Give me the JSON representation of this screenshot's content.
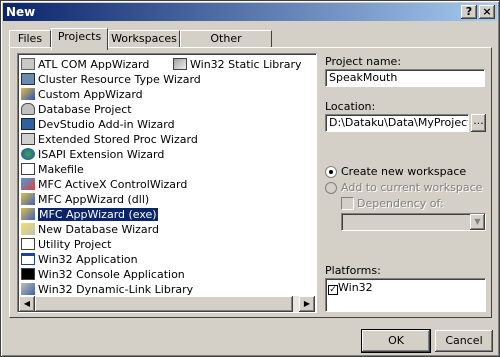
{
  "window": {
    "title": "New",
    "help_glyph": "?",
    "close_glyph": "×"
  },
  "tabs": [
    {
      "label": "Files"
    },
    {
      "label": "Projects"
    },
    {
      "label": "Workspaces"
    },
    {
      "label": "Other Documents"
    }
  ],
  "projects_list": {
    "column1": [
      "ATL COM AppWizard",
      "Cluster Resource Type Wizard",
      "Custom AppWizard",
      "Database Project",
      "DevStudio Add-in Wizard",
      "Extended Stored Proc Wizard",
      "ISAPI Extension Wizard",
      "Makefile",
      "MFC ActiveX ControlWizard",
      "MFC AppWizard (dll)",
      "MFC AppWizard (exe)",
      "New Database Wizard",
      "Utility Project",
      "Win32 Application",
      "Win32 Console Application",
      "Win32 Dynamic-Link Library"
    ],
    "column2": [
      "Win32 Static Library"
    ],
    "selected": "MFC AppWizard (exe)"
  },
  "project_name": {
    "label": "Project name:",
    "value": "SpeakMouth"
  },
  "location": {
    "label": "Location:",
    "value": "D:\\Dataku\\Data\\MyProject\\Visu",
    "browse_label": "..."
  },
  "workspace": {
    "create_new": "Create new workspace",
    "add_current": "Add to current workspace",
    "dependency": "Dependency of:"
  },
  "platforms": {
    "label": "Platforms:",
    "items": [
      "Win32"
    ]
  },
  "buttons": {
    "ok": "OK",
    "cancel": "Cancel"
  }
}
